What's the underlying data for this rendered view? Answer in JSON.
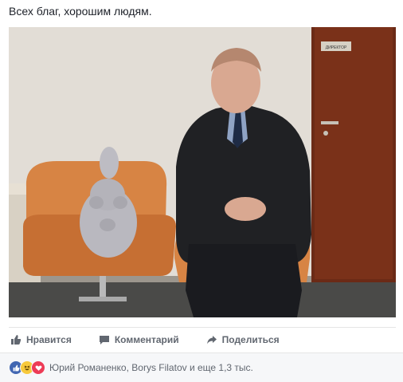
{
  "post": {
    "text": "Всех благ, хорошим людям."
  },
  "photo": {
    "door_sign": "ДИРЕКТОР"
  },
  "actions": {
    "like": "Нравится",
    "comment": "Комментарий",
    "share": "Поделиться"
  },
  "reactions": {
    "icons": [
      "like-reaction-icon",
      "haha-reaction-icon",
      "love-reaction-icon"
    ],
    "summary": "Юрий Романенко, Borys Filatov и еще 1,3 тыс."
  },
  "colors": {
    "like_blue": "#4267b2",
    "haha_yellow": "#f7c93c",
    "love_red": "#ed3b56",
    "action_gray": "#616770"
  }
}
